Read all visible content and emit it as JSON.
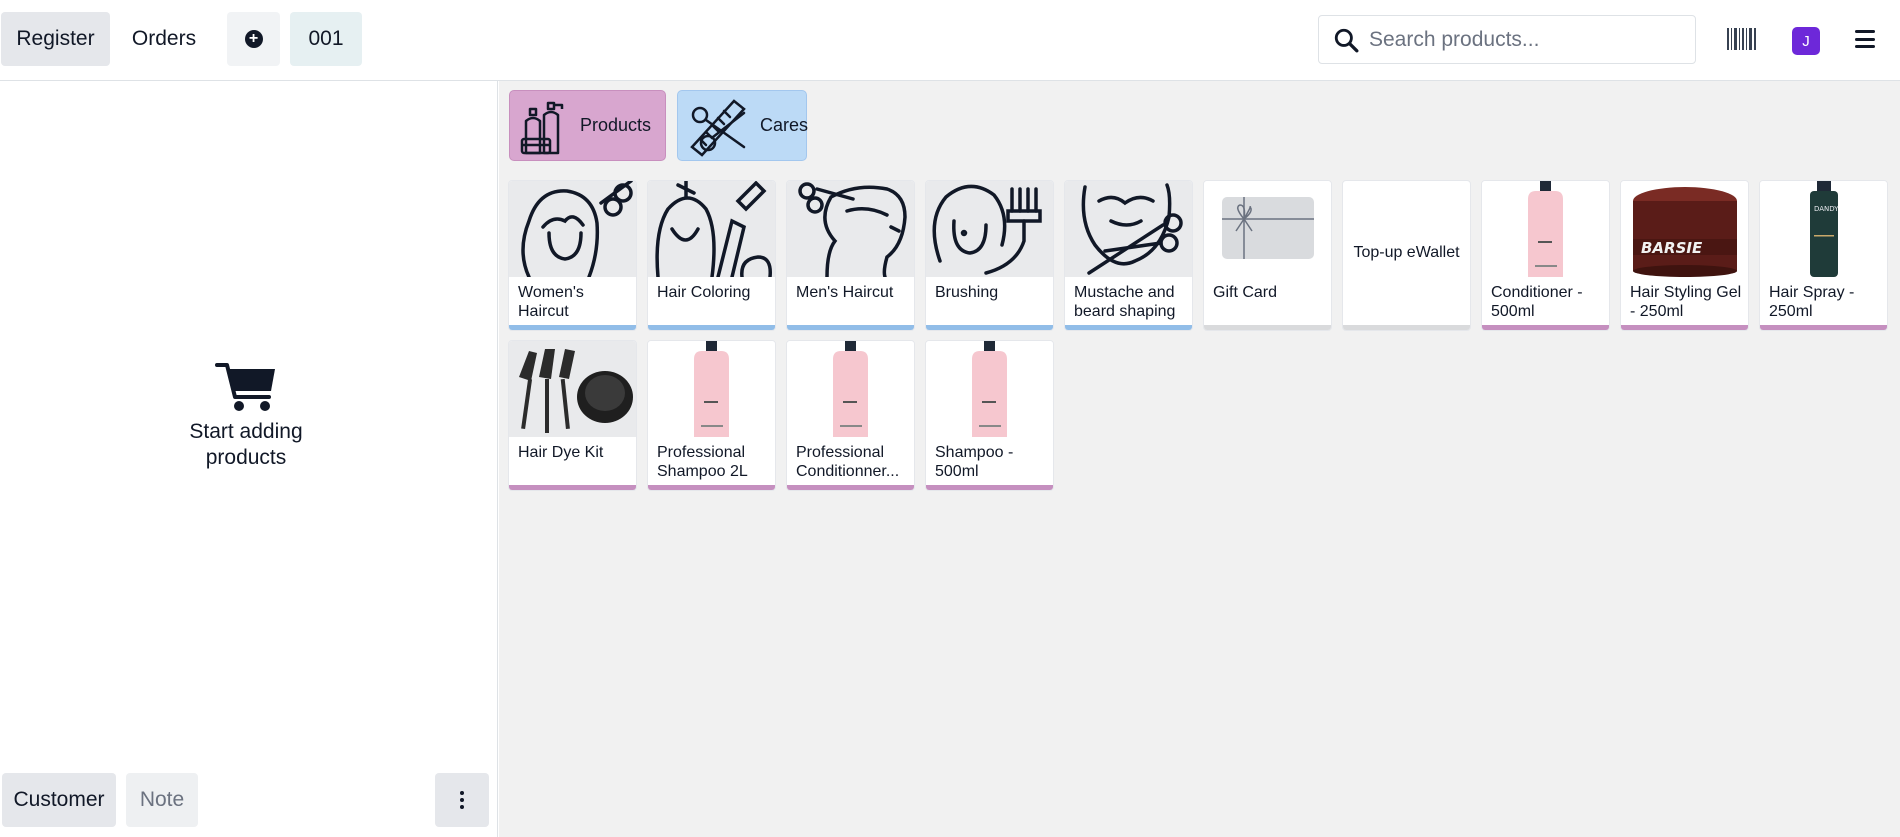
{
  "navbar": {
    "register_label": "Register",
    "orders_label": "Orders",
    "order_tab_label": "001",
    "search_placeholder": "Search products...",
    "avatar_initial": "J"
  },
  "order_panel": {
    "empty_message": "Start adding products",
    "customer_label": "Customer",
    "note_label": "Note"
  },
  "categories": [
    {
      "label": "Products",
      "color": "#d8a6cf"
    },
    {
      "label": "Cares",
      "color": "#bcdaf6"
    }
  ],
  "products": [
    {
      "name": "Women's Haircut",
      "category": "Cares",
      "icon": "woman-haircut-icon"
    },
    {
      "name": "Hair Coloring",
      "category": "Cares",
      "icon": "hair-coloring-icon"
    },
    {
      "name": "Men's Haircut",
      "category": "Cares",
      "icon": "men-haircut-icon"
    },
    {
      "name": "Brushing",
      "category": "Cares",
      "icon": "brushing-icon"
    },
    {
      "name": "Mustache and beard shaping",
      "category": "Cares",
      "icon": "beard-shaping-icon"
    },
    {
      "name": "Gift Card",
      "category": "",
      "icon": "gift-card-icon"
    },
    {
      "name": "Top-up eWallet",
      "category": "",
      "icon": ""
    },
    {
      "name": "Conditioner - 500ml",
      "category": "Products",
      "icon": "pink-bottle-image"
    },
    {
      "name": "Hair Styling Gel - 250ml",
      "category": "Products",
      "icon": "gel-jar-image"
    },
    {
      "name": "Hair Spray - 250ml",
      "category": "Products",
      "icon": "spray-can-image"
    },
    {
      "name": "Hair Dye Kit",
      "category": "Products",
      "icon": "dye-kit-image"
    },
    {
      "name": "Professional Shampoo 2L",
      "category": "Products",
      "icon": "pink-bottle-image"
    },
    {
      "name": "Professional Conditionner...",
      "category": "Products",
      "icon": "pink-bottle-image"
    },
    {
      "name": "Shampoo - 500ml",
      "category": "Products",
      "icon": "pink-bottle-image"
    }
  ]
}
